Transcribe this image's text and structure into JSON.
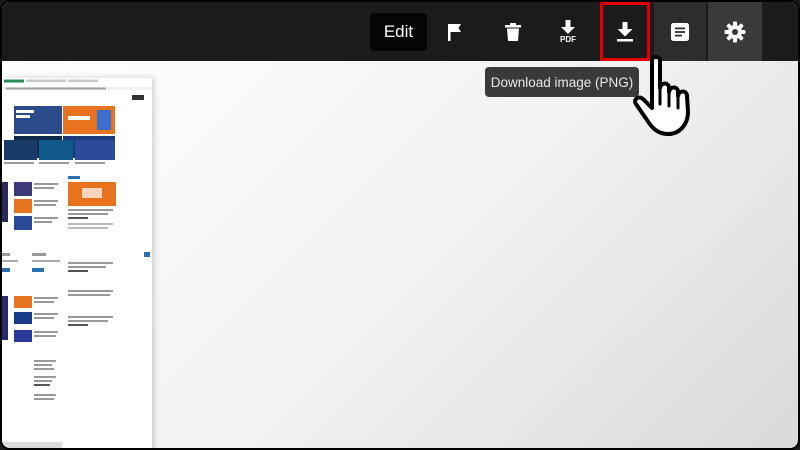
{
  "toolbar": {
    "edit_label": "Edit",
    "pdf_label": "PDF",
    "buttons": [
      {
        "name": "flag-button",
        "icon": "flag-icon"
      },
      {
        "name": "delete-button",
        "icon": "trash-icon"
      },
      {
        "name": "download-pdf-button",
        "icon": "download-pdf-icon"
      },
      {
        "name": "download-png-button",
        "icon": "download-icon"
      },
      {
        "name": "notes-button",
        "icon": "notes-icon"
      },
      {
        "name": "settings-button",
        "icon": "gear-icon"
      }
    ]
  },
  "tooltip": {
    "text": "Download image (PNG)"
  },
  "colors": {
    "toolbar_bg": "#1b1b1b",
    "highlight": "#e00000",
    "tooltip_bg": "#3a3a3a",
    "accent_orange": "#e8731e",
    "accent_blue": "#2a6fb0"
  }
}
